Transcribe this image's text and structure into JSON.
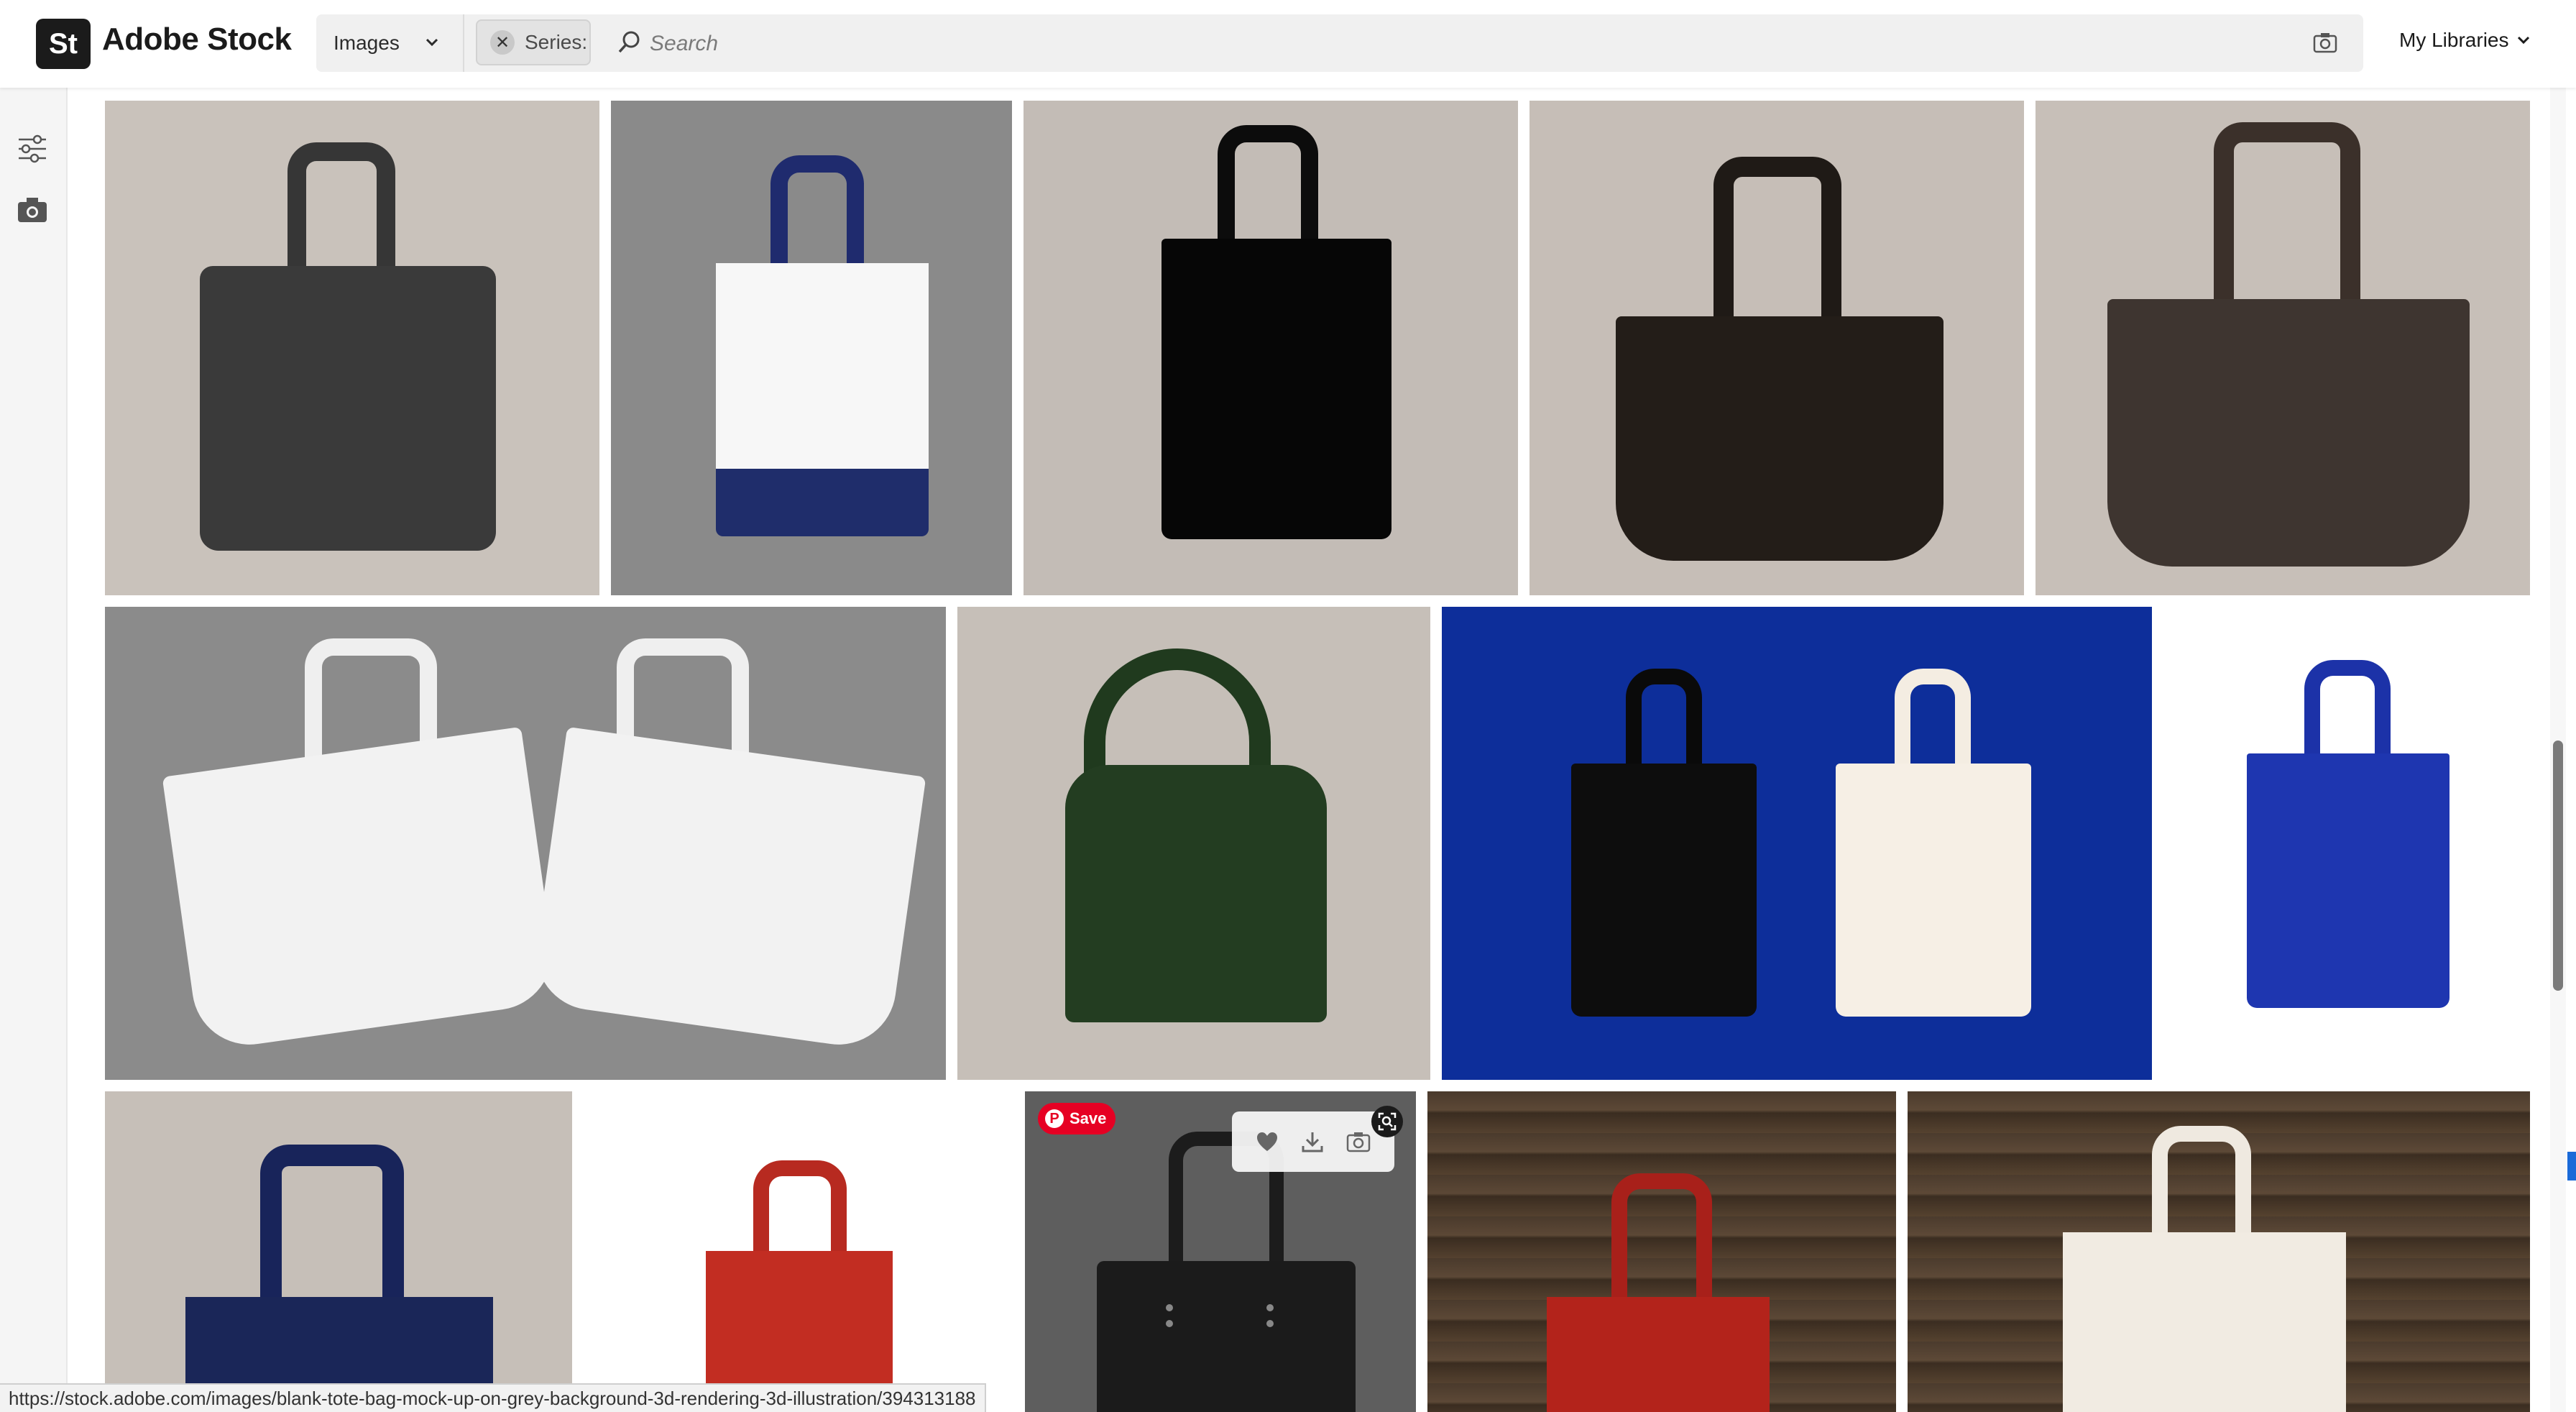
{
  "header": {
    "logo_badge": "St",
    "logo_text": "Adobe Stock",
    "type_select": "Images",
    "series_chip_label": "Series:",
    "search_placeholder": "Search",
    "libraries_label": "My Libraries"
  },
  "rail": {
    "icons": [
      "filters-icon",
      "camera-icon"
    ]
  },
  "tile_overlay": {
    "save_label": "Save",
    "actions": [
      "heart-icon",
      "download-icon",
      "camera-search-icon"
    ]
  },
  "status_bar": {
    "url": "https://stock.adobe.com/images/blank-tote-bag-mock-up-on-grey-background-3d-rendering-3d-illustration/394313188"
  },
  "colors": {
    "accent_black": "#1b1b1b",
    "pinterest_red": "#e60023",
    "search_bg": "#f0f0f0"
  }
}
